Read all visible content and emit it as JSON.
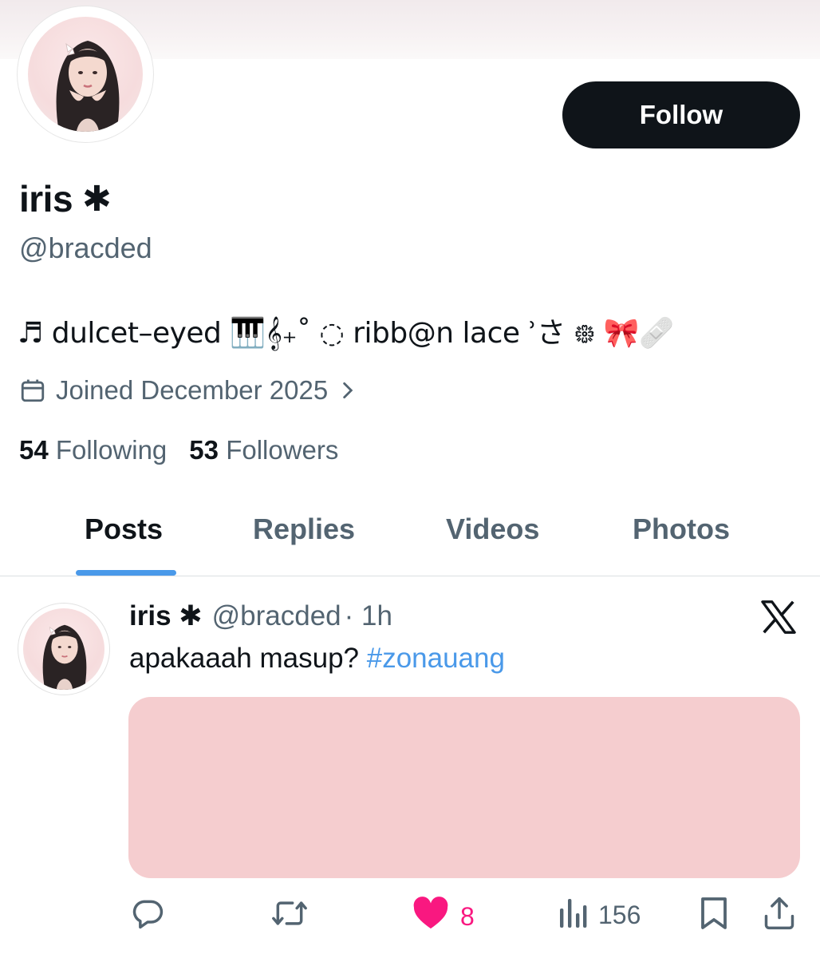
{
  "profile": {
    "display_name": "iris",
    "name_symbol": "✱",
    "handle": "@bracded",
    "bio": "♬ dulcet–eyed 🎹𝄞₊˚ ◌ ribb@n lace ʾさ ᪥ 🎀🩹",
    "joined": "Joined December 2025",
    "follow_label": "Follow",
    "following_count": "54",
    "following_label": "Following",
    "followers_count": "53",
    "followers_label": "Followers"
  },
  "tabs": [
    {
      "label": "Posts",
      "active": true
    },
    {
      "label": "Replies",
      "active": false
    },
    {
      "label": "Videos",
      "active": false
    },
    {
      "label": "Photos",
      "active": false
    }
  ],
  "post": {
    "author_name": "iris",
    "author_symbol": "✱",
    "author_handle": "@bracded",
    "time": "· 1h",
    "text": "apakaaah masup?",
    "hashtag": "#zonauang",
    "media_color": "#f5cdcf",
    "likes": "8",
    "views": "156",
    "actions": {
      "reply_icon": "reply-icon",
      "repost_icon": "repost-icon",
      "like_icon": "heart-filled-icon",
      "views_icon": "views-chart-icon",
      "bookmark_icon": "bookmark-icon",
      "share_icon": "share-icon"
    }
  },
  "colors": {
    "accent": "#4a99e9",
    "like": "#f91880",
    "text_primary": "#0f1419",
    "text_secondary": "#536471",
    "button_bg": "#0f1419"
  }
}
